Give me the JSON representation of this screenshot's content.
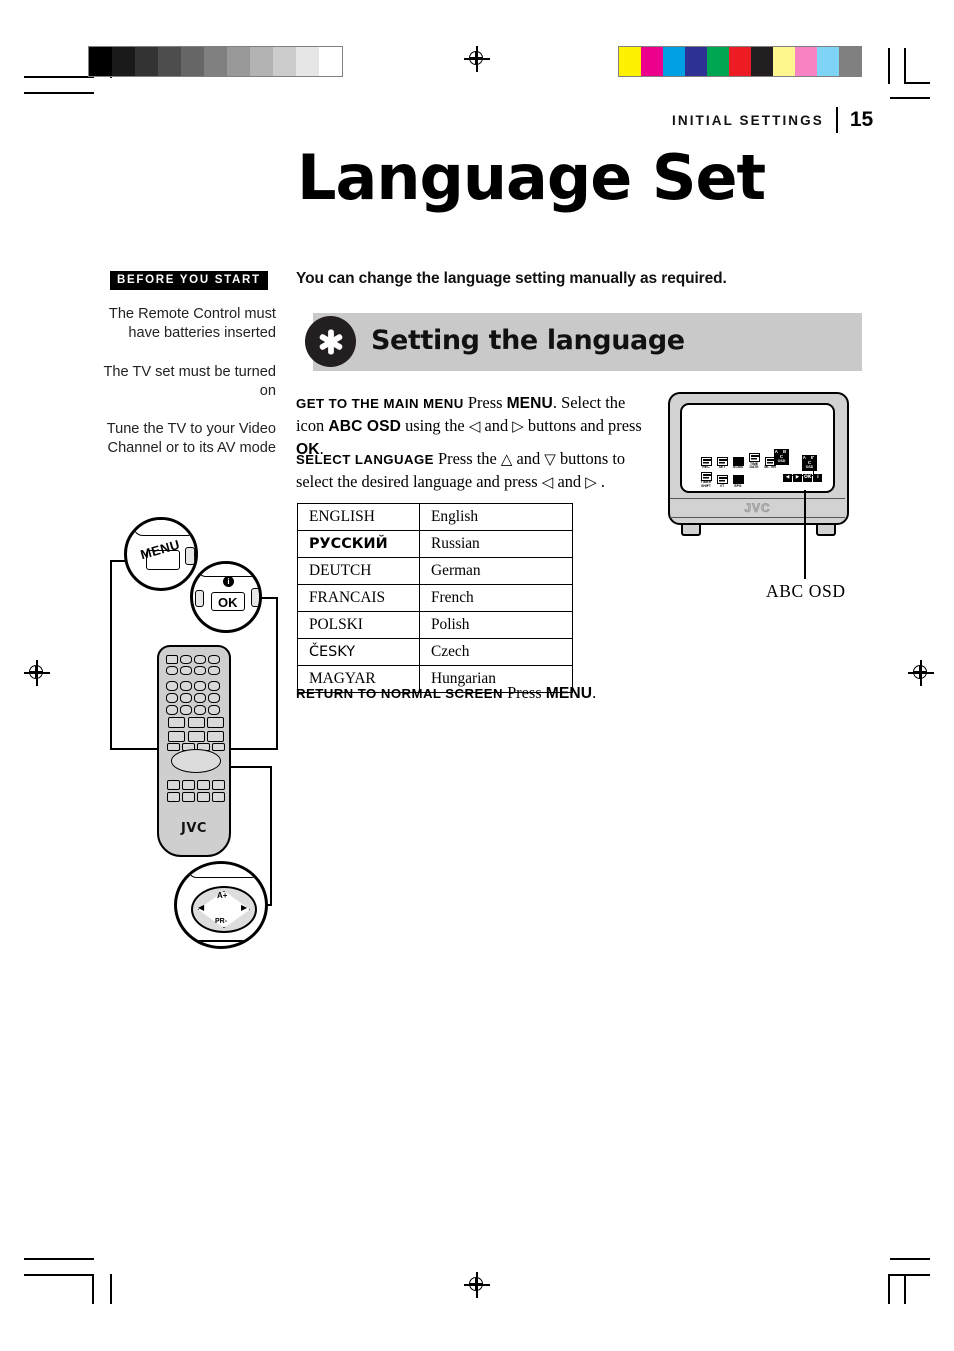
{
  "running_head": {
    "label": "INITIAL SETTINGS",
    "page_number": "15"
  },
  "page_title": "Language Set",
  "before_you_start": {
    "tag": "BEFORE YOU START",
    "notes": [
      "The Remote Control must have batteries inserted",
      "The TV set must be turned on",
      "Tune the TV to your Video Channel or to its AV mode"
    ]
  },
  "intro": "You can change the language setting manually as required.",
  "section": {
    "icon": "asterisk-flower-icon",
    "title": "Setting the language",
    "bar_color": "#c9c9c9",
    "badge_color": "#231f20"
  },
  "steps": {
    "get_to_main_menu": {
      "lead": "GET TO THE MAIN MENU",
      "text_1": "Press",
      "key_1": "MENU",
      "text_2": ". Select the icon",
      "key_2": "ABC OSD",
      "text_3": "using the",
      "arrow_left": "◁",
      "text_4": "and",
      "arrow_right": "▷",
      "text_5": "buttons and press",
      "key_3": "OK",
      "text_6": "."
    },
    "select_language": {
      "lead": "SELECT LANGUAGE",
      "text_1": "Press the",
      "arrow_up": "△",
      "text_2": "and",
      "arrow_down": "▽",
      "text_3": "buttons to select the desired language and press",
      "arrow_left": "◁",
      "text_4": "and",
      "arrow_right": "▷",
      "text_5": "."
    },
    "return_to_normal": {
      "lead": "RETURN TO NORMAL SCREEN",
      "text_1": "Press",
      "key_1": "MENU",
      "text_2": "."
    }
  },
  "language_table": {
    "rows": [
      {
        "native": "ENGLISH",
        "english": "English",
        "script": "latin"
      },
      {
        "native": "РУССКИЙ",
        "english": "Russian",
        "script": "cyrillic"
      },
      {
        "native": "DEUTCH",
        "english": "German",
        "script": "latin"
      },
      {
        "native": "FRANCAIS",
        "english": "French",
        "script": "latin"
      },
      {
        "native": "POLSKI",
        "english": "Polish",
        "script": "latin"
      },
      {
        "native": "ČESKY",
        "english": "Czech",
        "script": "czech"
      },
      {
        "native": "MAGYAR",
        "english": "Hungarian",
        "script": "latin"
      }
    ]
  },
  "tv_illustration": {
    "brand": "JVC",
    "callout_caption": "ABC OSD",
    "osd_icons_row1": [
      {
        "label": "REC",
        "name": "rec-icon"
      },
      {
        "label": "SET",
        "name": "set-icon"
      },
      {
        "label": "ACMS",
        "name": "acms-icon"
      },
      {
        "label": "TIME DATE",
        "name": "time-date-icon"
      },
      {
        "label": "MI- TIN",
        "name": "misc-icon"
      }
    ],
    "osd_icons_row2": [
      {
        "label": "TIMER SHIFT",
        "name": "timer-shift-icon"
      },
      {
        "label": "VT",
        "name": "vt-icon"
      },
      {
        "label": "EPG",
        "name": "epg-icon"
      }
    ],
    "osd_abc_main": {
      "line1": "A B",
      "line2": "C",
      "line3": "OSD"
    },
    "osd_abc_selected": {
      "line1": "A B",
      "line2": "C",
      "line3": "OSD"
    },
    "osd_nav": [
      "◀",
      "▶",
      "OK",
      "i"
    ]
  },
  "remote_illustration": {
    "brand": "JVC",
    "callouts": [
      {
        "name": "menu-button-callout",
        "label": "MENU"
      },
      {
        "name": "ok-button-callout",
        "label": "OK",
        "badge": "i"
      },
      {
        "name": "dpad-callout",
        "label_up": "A+",
        "label_down": "PR-",
        "label_left": "◀",
        "label_right": "▶"
      }
    ]
  },
  "print_marks": {
    "greyscale_steps": [
      "#000000",
      "#1a1a1a",
      "#333333",
      "#4d4d4d",
      "#666666",
      "#808080",
      "#999999",
      "#b3b3b3",
      "#cccccc",
      "#e6e6e6",
      "#ffffff"
    ],
    "color_steps": [
      "#fff200",
      "#ec008c",
      "#00a0e3",
      "#2e3192",
      "#00a651",
      "#ed1c24",
      "#231f20",
      "#fff68f",
      "#f783c5",
      "#7fd4f5",
      "#808080"
    ]
  }
}
